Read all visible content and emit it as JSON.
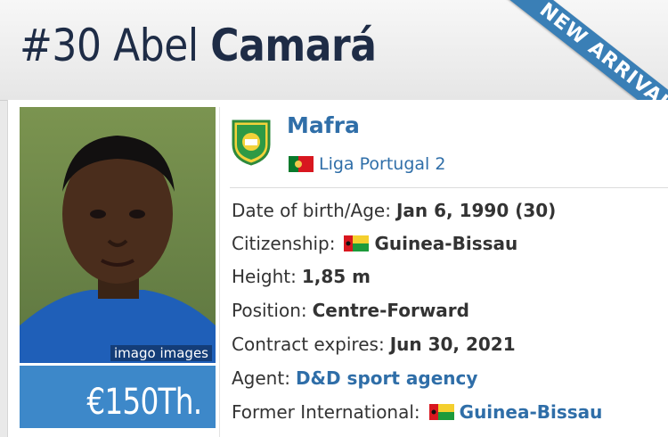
{
  "header": {
    "number": "#30",
    "first_name": "Abel",
    "last_name": "Camará",
    "ribbon": "NEW ARRIVAL"
  },
  "photo": {
    "credit": "imago images"
  },
  "market_value": "€150Th.",
  "club": {
    "name": "Mafra",
    "league": "Liga Portugal 2",
    "league_flag": "portugal-flag-icon"
  },
  "info": {
    "dob_label": "Date of birth/Age:",
    "dob_value": "Jan 6, 1990 (30)",
    "citizenship_label": "Citizenship:",
    "citizenship_value": "Guinea-Bissau",
    "height_label": "Height:",
    "height_value": "1,85 m",
    "position_label": "Position:",
    "position_value": "Centre-Forward",
    "contract_label": "Contract expires:",
    "contract_value": "Jun 30, 2021",
    "agent_label": "Agent:",
    "agent_value": "D&D sport agency",
    "intl_label": "Former International:",
    "intl_value": "Guinea-Bissau"
  },
  "colors": {
    "accent": "#3d88c9",
    "link": "#2f6ea8",
    "title": "#1e2c46"
  }
}
